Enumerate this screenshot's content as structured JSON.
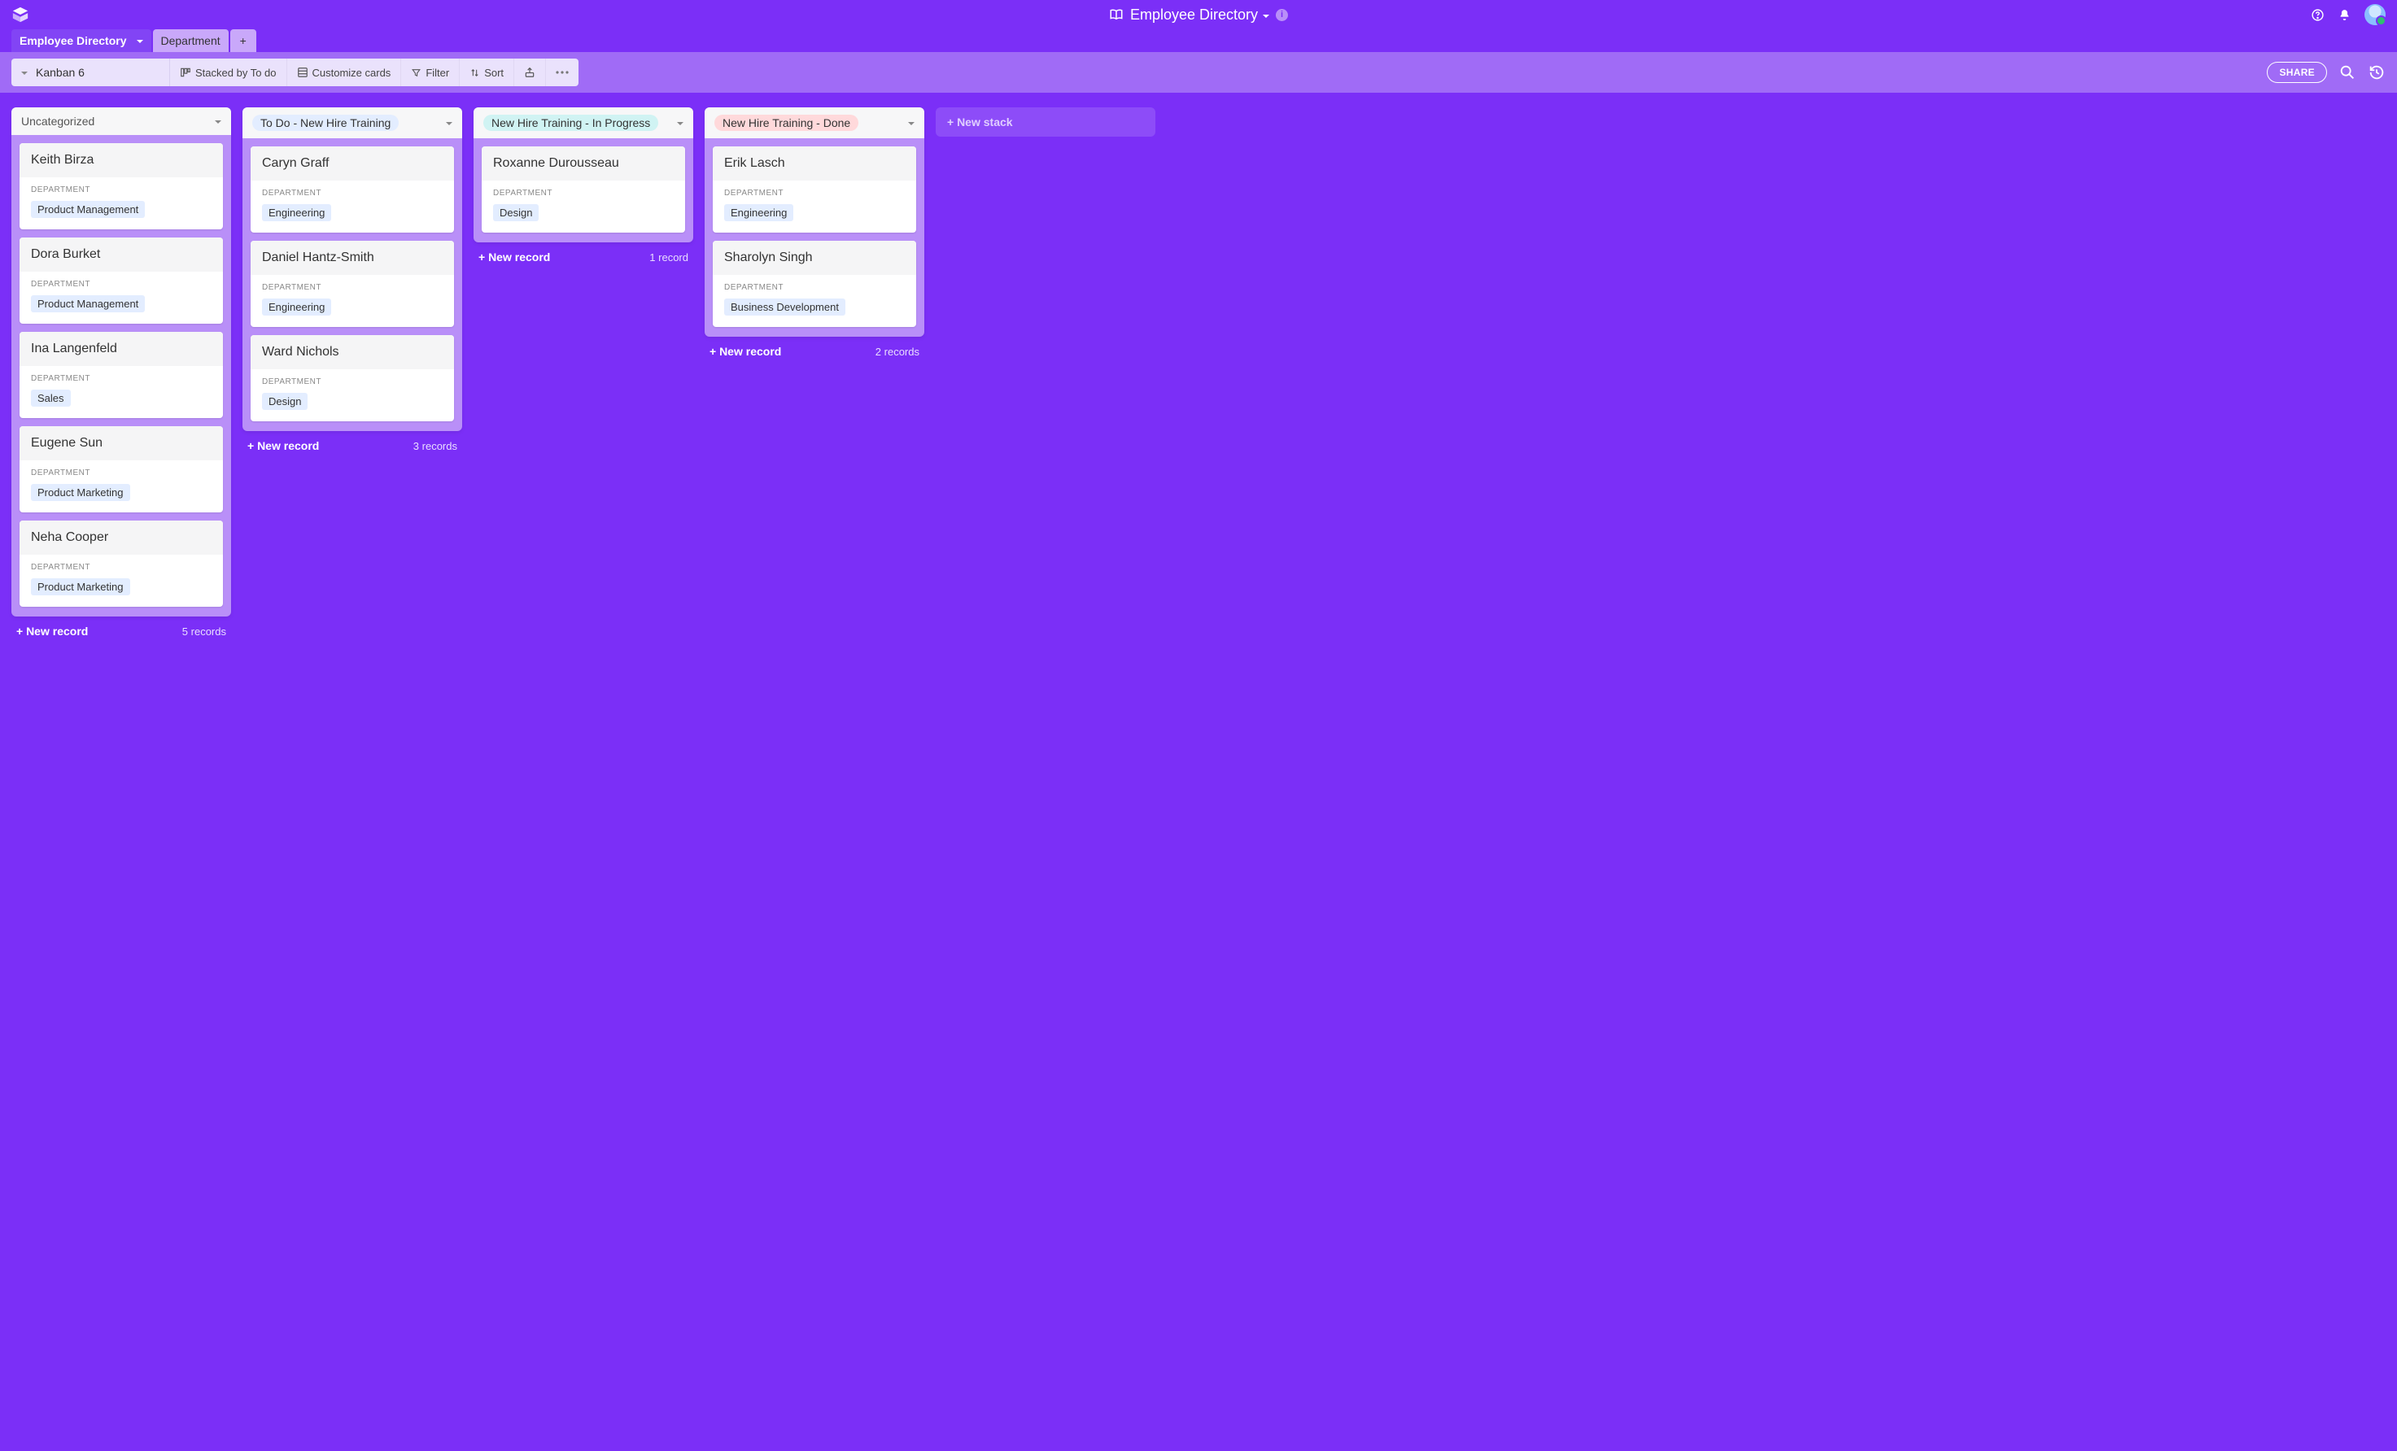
{
  "app_title": "Employee Directory",
  "tabs": {
    "active": "Employee Directory",
    "inactive": "Department"
  },
  "view_name": "Kanban 6",
  "toolbar": {
    "stacked_by": "Stacked by To do",
    "customize": "Customize cards",
    "filter": "Filter",
    "sort": "Sort",
    "share": "SHARE"
  },
  "field_label": "DEPARTMENT",
  "new_record_label": "+ New record",
  "new_stack_label": "+ New stack",
  "columns": [
    {
      "title": "Uncategorized",
      "pill": "none",
      "count": "5 records",
      "records": [
        {
          "name": "Keith Birza",
          "department": "Product Management"
        },
        {
          "name": "Dora Burket",
          "department": "Product Management"
        },
        {
          "name": "Ina Langenfeld",
          "department": "Sales"
        },
        {
          "name": "Eugene Sun",
          "department": "Product Marketing"
        },
        {
          "name": "Neha Cooper",
          "department": "Product Marketing"
        }
      ]
    },
    {
      "title": "To Do - New Hire Training",
      "pill": "blue",
      "count": "3 records",
      "records": [
        {
          "name": "Caryn Graff",
          "department": "Engineering"
        },
        {
          "name": "Daniel Hantz-Smith",
          "department": "Engineering"
        },
        {
          "name": "Ward Nichols",
          "department": "Design"
        }
      ]
    },
    {
      "title": "New Hire Training - In Progress",
      "pill": "cyan",
      "count": "1 record",
      "records": [
        {
          "name": "Roxanne Durousseau",
          "department": "Design"
        }
      ]
    },
    {
      "title": "New Hire Training - Done",
      "pill": "red",
      "count": "2 records",
      "records": [
        {
          "name": "Erik Lasch",
          "department": "Engineering"
        },
        {
          "name": "Sharolyn Singh",
          "department": "Business Development"
        }
      ]
    }
  ]
}
